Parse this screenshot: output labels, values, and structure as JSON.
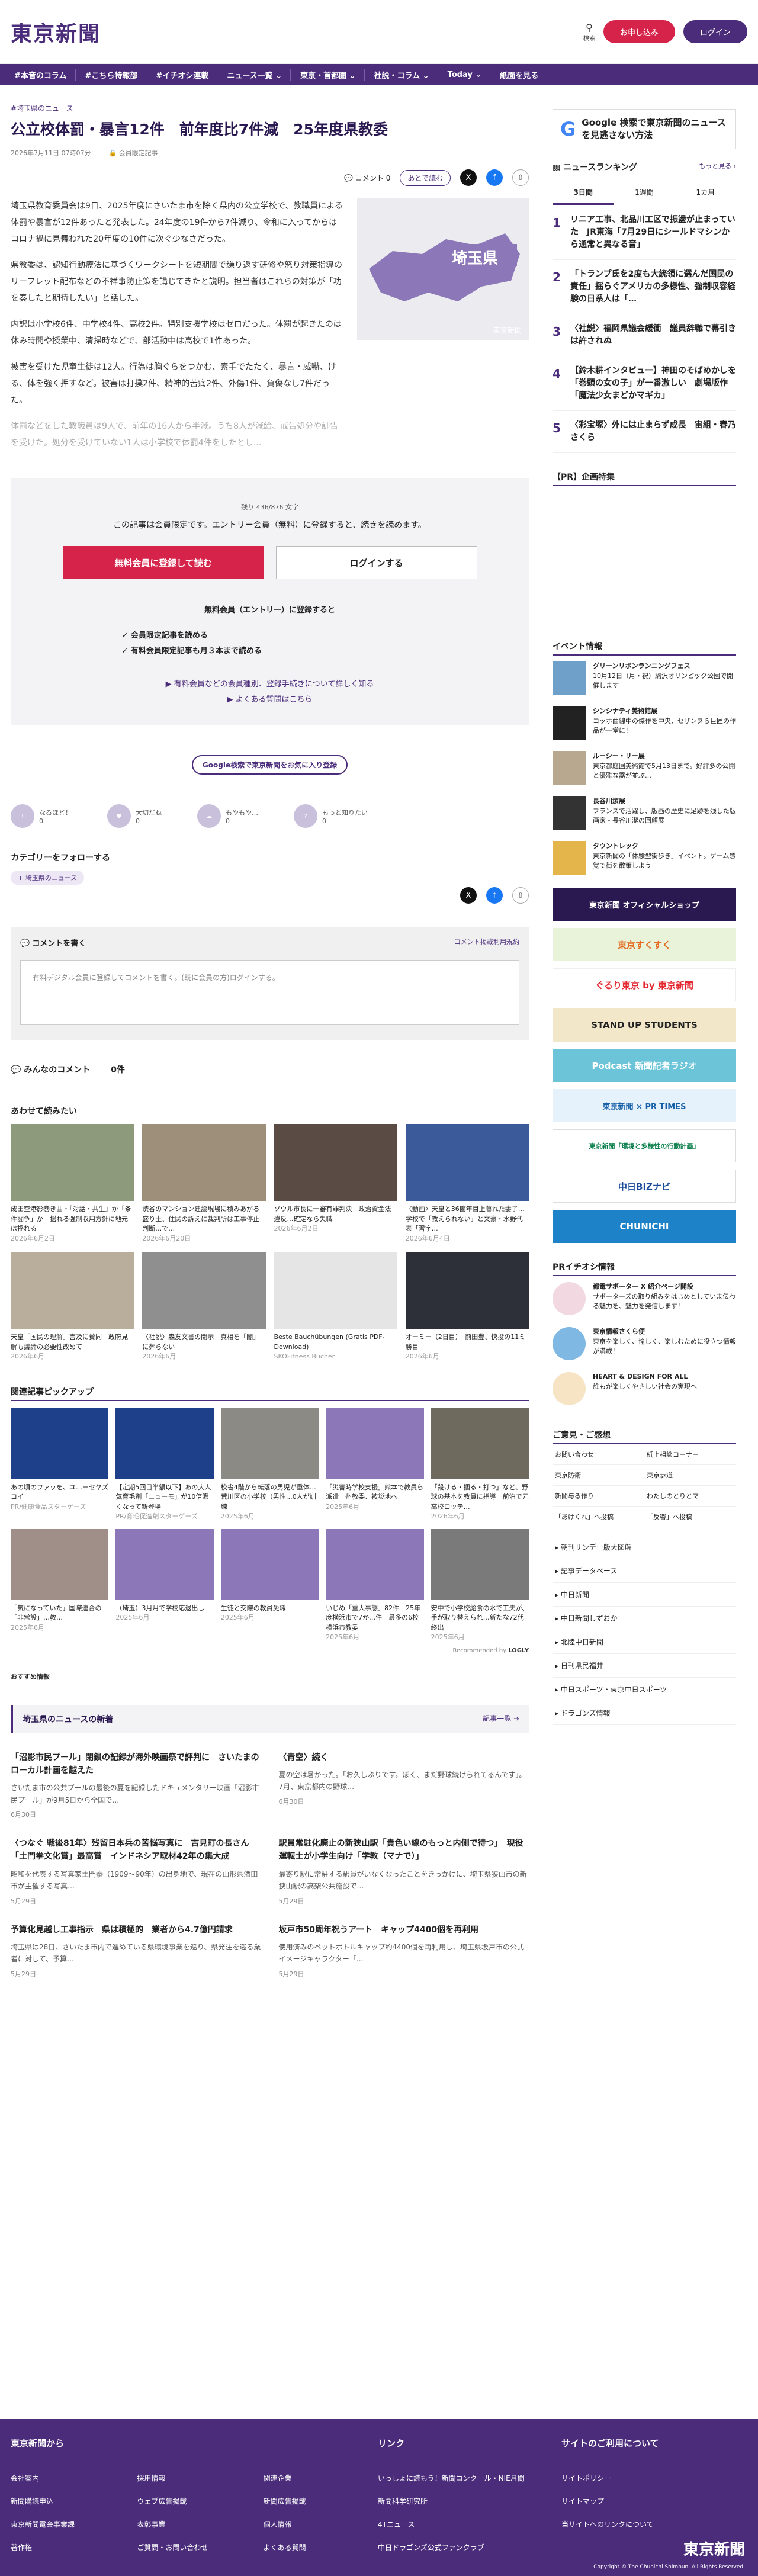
{
  "header": {
    "logo": "東京新聞",
    "search_label": "検索",
    "register": "お申し込み",
    "login": "ログイン"
  },
  "nav": [
    "#本音のコラム",
    "#こちら特報部",
    "#イチオシ連載",
    "ニュース一覧 ⌄",
    "東京・首都圏 ⌄",
    "社説・コラム ⌄",
    "Today ⌄",
    "紙面を見る"
  ],
  "article": {
    "crumb": "#埼玉県のニュース",
    "title": "公立校体罰・暴言12件　前年度比7件減　25年度県教委",
    "date": "2026年7月11日 07時07分",
    "badge": "会員限定記事",
    "comment_label": "コメント",
    "comment_count": "0",
    "later": "あとで読む",
    "fig_label": "埼玉県",
    "fig_credit": "東京新聞",
    "p1": "埼玉県教育委員会は9日、2025年度にさいたま市を除く県内の公立学校で、教職員による体罰や暴言が12件あったと発表した。24年度の19件から7件減り、令和に入ってからはコロナ禍に見舞われた20年度の10件に次ぐ少なさだった。",
    "p2": "県教委は、認知行動療法に基づくワークシートを短期間で繰り返す研修や怒り対策指導のリーフレット配布などの不祥事防止策を講じてきたと説明。担当者はこれらの対策が「功を奏したと期待したい」と話した。",
    "p3": "内訳は小学校6件、中学校4件、高校2件。特別支援学校はゼロだった。体罰が起きたのは休み時間や授業中、清掃時などで、部活動中は高校で1件あった。",
    "p4": "被害を受けた児童生徒は12人。行為は胸ぐらをつかむ、素手でたたく、暴言・威嚇、ける、体を強く押すなど。被害は打撲2件、精神的苦痛2件、外傷1件、負傷なし7件だった。",
    "p5": "体罰などをした教職員は9人で、前年の16人から半減。うち8人が減給、戒告処分や訓告を受けた。処分を受けていない1人は小学校で体罰4件をしたとし..."
  },
  "paywall": {
    "remaining": "残り 436/876 文字",
    "msg": "この記事は会員限定です。エントリー会員（無料）に登録すると、続きを読めます。",
    "register_btn": "無料会員に登録して読む",
    "login_btn": "ログインする",
    "benefit_title": "無料会員（エントリー）に登録すると",
    "b1": "✓ 会員限定記事を読める",
    "b2": "✓ 有料会員限定記事も月３本まで読める",
    "link1": "▶ 有料会員などの会員種別、登録手続きについて詳しく知る",
    "link2": "▶ よくある質問はこちら",
    "google": "Google検索で東京新聞をお気に入り登録"
  },
  "reactions": [
    {
      "l": "なるほど！",
      "c": "0"
    },
    {
      "l": "大切だね",
      "c": "0"
    },
    {
      "l": "もやもや…",
      "c": "0"
    },
    {
      "l": "もっと知りたい",
      "c": "0"
    }
  ],
  "category": {
    "title": "カテゴリーをフォローする",
    "tag": "+ 埼玉県のニュース"
  },
  "comment": {
    "title": "コメントを書く",
    "rule": "コメント掲載利用規約",
    "placeholder": "有料デジタル会員に登録してコメントを書く。(既に会員の方)ログインする。"
  },
  "allcomment": {
    "title": "みんなのコメント",
    "count": "0件"
  },
  "related": {
    "title": "あわせて読みたい",
    "items": [
      {
        "t": "成田空港影巻き曲・「対話・共生」か「条件闘争」か　揺れる強制収用方針に地元は揺れる",
        "d": "2026年6月2日"
      },
      {
        "t": "渋谷のマンション建設現場に積みあがる盛り土、住民の訴えに裁判所は工事停止判断…で…",
        "d": "2026年6月20日"
      },
      {
        "t": "ソウル市長に一審有罪判決　政治資金法違反…確定なら失職",
        "d": "2026年6月2日"
      },
      {
        "t": "〈動画〉天皇と36箇年目上暮れた妻子…学校で「教えられない」と文豪・水野代表「習字…",
        "d": "2026年6月4日"
      },
      {
        "t": "天皇「国民の理解」言及に賛同　政府見解も議論の必要性改めて",
        "d": "2026年6月"
      },
      {
        "t": "〈社説〉森友文書の開示　真相を「闇」に葬らない",
        "d": "2026年6月"
      },
      {
        "t": "Beste Bauchübungen (Gratis PDF-Download)",
        "d": "SKOFitness Bücher"
      },
      {
        "t": "オーミー（2日目）　前田豊、快投の11ミ勝目",
        "d": "2026年6月"
      }
    ]
  },
  "pickup": {
    "title": "関連記事ピックアップ",
    "items": [
      {
        "t": "あの頃のファッを、ユ…ーセヤズコイ",
        "d": "PR/健康食品スターゲーズ"
      },
      {
        "t": "【定期5回目半額以下】あの大人気育毛剤「ニューモ」が10倍濃くなって新登場",
        "d": "PR/育毛促進剤スターゲーズ"
      },
      {
        "t": "校舎4階から転落の男児が重体…荒川区の小学校（男性…0人が訓練",
        "d": "2025年6月"
      },
      {
        "t": "「災害時学校支援」熊本で教員ら派遣　州教委、被災地へ",
        "d": "2025年6月"
      },
      {
        "t": "「殺ける・掴る・打つ」など、野球の基本を教員に指導　前泊で元高校ロッテ…",
        "d": "2026年6月"
      },
      {
        "t": "「気になっていた」国際連合の「非常設」…教…",
        "d": "2025年6月"
      },
      {
        "t": "（埼玉）3月月で学校応退出し",
        "d": "2025年6月"
      },
      {
        "t": "生徒と交際の教員免職",
        "d": "2025年6月"
      },
      {
        "t": "いじめ「重大事態」82件　25年度横浜市で7か…件　最多の6校　横浜市教委",
        "d": "2025年6月"
      },
      {
        "t": "安中で小学校給食の水で工夫が、手が取り替えられ…新たな72代終出",
        "d": "2025年6月"
      }
    ],
    "recommend": "Recommended by",
    "recommend_brand": "LOGLY"
  },
  "recommend_title": "おすすめ情報",
  "latest": {
    "title": "埼玉県のニュースの新着",
    "more": "記事一覧 ➔",
    "items": [
      {
        "h": "「沼影市民プール」閉鎖の記録が海外映画祭で評判に　さいたまのローカル計画を越えた",
        "d": "さいたま市の公共プールの最後の夏を記録したドキュメンタリー映画「沼影市民プール」が9月5日から全国で…",
        "t": "6月30日"
      },
      {
        "h": "〈青空〉続く",
        "d": "夏の空は暑かった。「お久しぶりです。ぼく、まだ野球続けられてるんです」。7月、東京都内の野球…",
        "t": "6月30日"
      },
      {
        "h": "〈つなぐ 戦後81年〉残留日本兵の苦悩写真に　吉見町の長さん「土門拳文化賞」最高賞　インドネシア取材42年の集大成",
        "d": "昭和を代表する写真家土門拳（1909〜90年）の出身地で、現在の山形県酒田市が主催する写真…",
        "t": "5月29日"
      },
      {
        "h": "駅員常駐化廃止の新狭山駅「貴色い線のもっと内側で待つ」　現役運転士が小学生向け「学教（マナで）」",
        "d": "最寄り駅に常駐する駅員がいなくなったことをきっかけに、埼玉県狭山市の新狭山駅の高架公共施設で…",
        "t": "5月29日"
      },
      {
        "h": "予算化見越し工事指示　県は積極的　業者から4.7億円請求",
        "d": "埼玉県は28日、さいたま市内で進めている県環境事業を巡り、県発注を巡る業者に対して、予算…",
        "t": "5月29日"
      },
      {
        "h": "坂戸市50周年祝うアート　キャップ4400個を再利用",
        "d": "使用済みのペットボトルキャップ約4400個を再利用し、埼玉県坂戸市の公式イメージキャラクター「…",
        "t": "5月29日"
      }
    ]
  },
  "sidebar": {
    "google_banner": "Google 検索で東京新聞のニュースを見逃さない方法",
    "ranking_title": "ニュースランキング",
    "ranking_more": "もっと見る ›",
    "tabs": [
      "3日間",
      "1週間",
      "1カ月"
    ],
    "ranking": [
      "リニア工事、北品川工区で振盪が止まっていた　JR東海「7月29日にシールドマシンから通常と異なる音」",
      "「トランプ氏を2度も大統領に選んだ国民の責任」揺らぐアメリカの多様性、強制収容経験の日系人は「…",
      "〈社説〉福岡県議会緩衝　議員辞職で幕引きは許されぬ",
      "【鈴木耕インタビュー】神田のそばめかしを「巻頭の女の子」が一番激しい　劇場版作「魔法少女まどかマギカ」",
      "〈彩宝塚〉外には止まらず成長　宙組・春乃さくら"
    ],
    "pr_title": "【PR】企画特集",
    "event_title": "イベント情報",
    "events": [
      {
        "h": "グリーンリボンランニングフェス",
        "d": "10月12日（月・祝）駒沢オリンピック公園で開催します"
      },
      {
        "h": "シンシナティ美術館展",
        "d": "コッホ曲線中の傑作を中央、セザンヌら巨匠の作品が一堂に！"
      },
      {
        "h": "ルーシー・リー展",
        "d": "東京都庭園美術館で5月13日まで。好評多の公開と優雅な器が並ぶ…"
      },
      {
        "h": "長谷川潔展",
        "d": "フランスで活躍し、版画の歴史に足跡を残した版画家・長谷川潔の回顧展"
      },
      {
        "h": "タウントレック",
        "d": "東京新聞の「体験型街歩き」イベント。ゲーム感覚で街を散策しよう"
      }
    ],
    "banners": [
      "東京新聞 オフィシャルショップ",
      "東京すくすく",
      "ぐるり東京 by 東京新聞",
      "STAND UP STUDENTS",
      "Podcast 新聞記者ラジオ",
      "東京新聞 × PR TIMES",
      "東京新聞「環境と多様性の行動計画」",
      "中日BIZナビ",
      "CHUNICHI"
    ],
    "pr_ichioshi": "PRイチオシ情報",
    "pr_items": [
      {
        "h": "都電サポーター X 紹介ページ開設",
        "d": "サポーターズの取り組みをはじめとしていま伝わる魅力を、魅力を発信します！"
      },
      {
        "h": "東京情報さくら便",
        "d": "東京を楽しく、愉しく、楽しむために役立つ情報が満載！"
      },
      {
        "h": "HEART & DESIGN FOR ALL",
        "d": "誰もが楽しくやさしい社会の実現へ"
      }
    ],
    "info_title": "ご意見・ご感想",
    "info_links": [
      "お問い合わせ",
      "紙上相談コーナー",
      "東京防衛",
      "東京歩道",
      "新聞与る作り",
      "わたしのとりとマ",
      "「あけくれ」へ投稿",
      "「反響」へ投稿"
    ],
    "list_links": [
      "朝刊サンデー版大図解",
      "記事データベース",
      "中日新聞",
      "中日新聞しずおか",
      "北陸中日新聞",
      "日刊県民福井",
      "中日スポーツ・東京中日スポーツ",
      "ドラゴンズ情報"
    ]
  },
  "footer": {
    "c1": "東京新聞から",
    "c1_links": [
      "会社案内",
      "採用情報",
      "関連企業",
      "新聞購読申込",
      "ウェブ広告掲載",
      "新聞広告掲載",
      "東京新聞電会事業課",
      "表彰事業",
      "個人情報",
      "著作権",
      "ご質問・お問い合わせ",
      "よくある質問"
    ],
    "c2": "リンク",
    "c2_links": [
      "いっしょに読もう！新聞コンクール・NIE月間",
      "新聞科学研究所",
      "4Tニュース",
      "中日ドラゴンズ公式ファンクラブ"
    ],
    "c3": "サイトのご利用について",
    "c3_links": [
      "サイトポリシー",
      "サイトマップ",
      "当サイトへのリンクについて"
    ],
    "logo": "東京新聞",
    "copy": "Copyright © The Chunichi Shimbun, All Rights Reserved."
  }
}
